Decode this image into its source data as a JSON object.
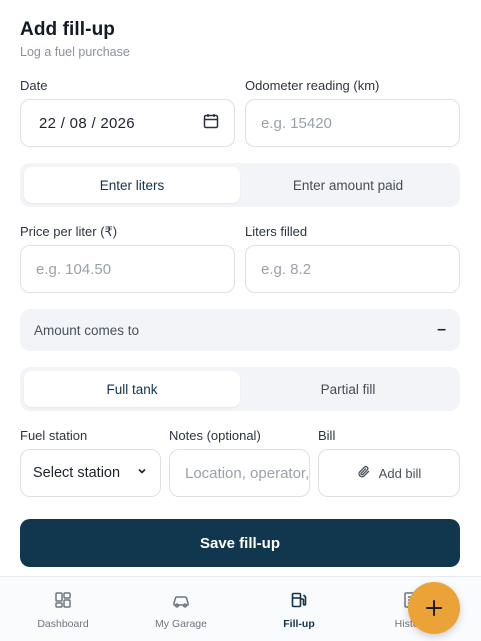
{
  "header": {
    "title": "Add fill-up",
    "subtitle": "Log a fuel purchase"
  },
  "form": {
    "date": {
      "label": "Date",
      "value": "22 / 08 / 2026"
    },
    "odometer": {
      "label": "Odometer reading (km)",
      "placeholder": "e.g. 15420"
    },
    "entry_mode": {
      "options": [
        "Enter liters",
        "Enter amount paid"
      ],
      "selected": "Enter liters"
    },
    "price": {
      "label": "Price per liter (₹)",
      "placeholder": "e.g. 104.50"
    },
    "liters": {
      "label": "Liters filled",
      "placeholder": "e.g. 8.2"
    },
    "amount": {
      "label": "Amount comes to",
      "value": "–"
    },
    "fill_type": {
      "options": [
        "Full tank",
        "Partial fill"
      ],
      "selected": "Full tank"
    },
    "station": {
      "label": "Fuel station",
      "value": "Select station"
    },
    "notes": {
      "label": "Notes (optional)",
      "placeholder": "Location, operator, etc."
    },
    "bill": {
      "label": "Bill",
      "button_label": "Add bill"
    },
    "save_label": "Save fill-up"
  },
  "nav": {
    "items": [
      {
        "label": "Dashboard",
        "icon": "dashboard-icon",
        "active": false
      },
      {
        "label": "My Garage",
        "icon": "car-icon",
        "active": false
      },
      {
        "label": "Fill-up",
        "icon": "fuel-pump-icon",
        "active": true
      },
      {
        "label": "History",
        "icon": "history-icon",
        "active": false
      }
    ],
    "fab_icon": "plus-icon"
  },
  "colors": {
    "primary": "#11374f",
    "accent": "#eba236",
    "surface": "#f2f4f7"
  }
}
